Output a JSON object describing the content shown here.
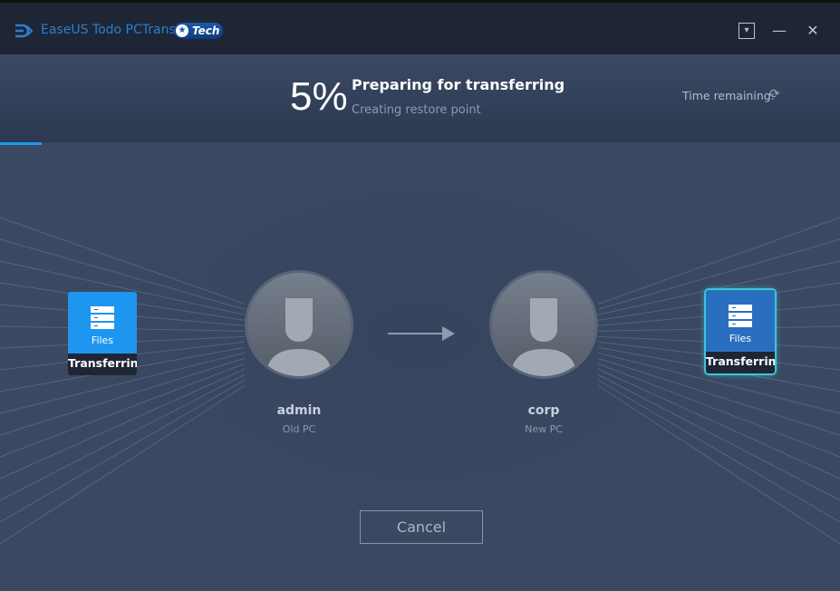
{
  "app": {
    "title": "EaseUS Todo PCTrans",
    "edition": "Tech"
  },
  "window": {
    "minimize_to_tray": "▾",
    "minimize": "—",
    "close": "✕"
  },
  "progress": {
    "percent_label": "5%",
    "percent": 5,
    "status": "Preparing for transferring",
    "substatus": "Creating restore point",
    "time_remaining_label": "Time remaining:"
  },
  "source": {
    "tile_label": "Files",
    "tile_status": "Transferring",
    "name": "admin",
    "role": "Old PC"
  },
  "target": {
    "tile_label": "Files",
    "tile_status": "Transferring",
    "name": "corp",
    "role": "New PC"
  },
  "cancel_label": "Cancel",
  "colors": {
    "accent": "#1a9bf0",
    "glow": "#3cc4d8"
  }
}
